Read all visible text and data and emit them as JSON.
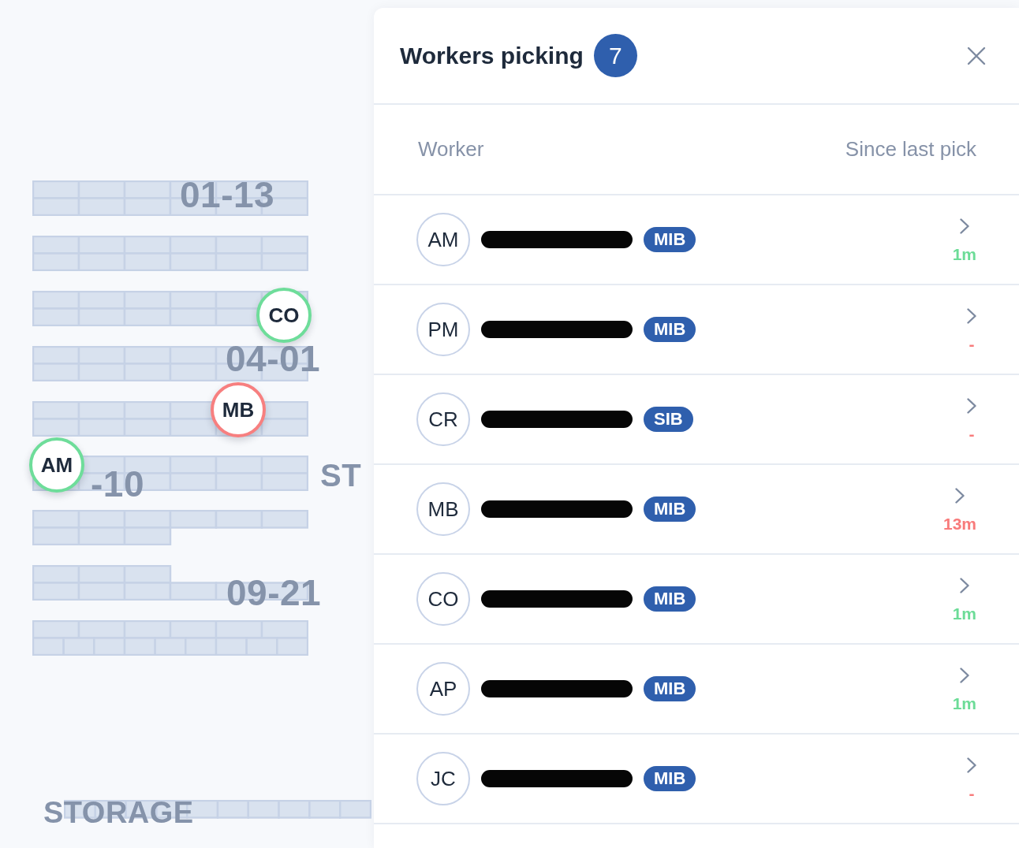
{
  "map": {
    "labels": [
      "01-13",
      "04-01",
      "-10",
      "09-21",
      "ST",
      "STORAGE"
    ],
    "markers": [
      {
        "initials": "CO",
        "color": "#6edd9a"
      },
      {
        "initials": "MB",
        "color": "#f77f7f"
      },
      {
        "initials": "AM",
        "color": "#6edd9a"
      }
    ]
  },
  "panel": {
    "title": "Workers picking",
    "count": "7",
    "columns": [
      "Worker",
      "Since last pick"
    ],
    "workers": [
      {
        "initials": "AM",
        "tag": "MIB",
        "since": "1m",
        "color": "#6cdc97"
      },
      {
        "initials": "PM",
        "tag": "MIB",
        "since": "-",
        "color": "#f87b7b"
      },
      {
        "initials": "CR",
        "tag": "SIB",
        "since": "-",
        "color": "#f87b7b"
      },
      {
        "initials": "MB",
        "tag": "MIB",
        "since": "13m",
        "color": "#f87b7b"
      },
      {
        "initials": "CO",
        "tag": "MIB",
        "since": "1m",
        "color": "#6cdc97"
      },
      {
        "initials": "AP",
        "tag": "MIB",
        "since": "1m",
        "color": "#6cdc97"
      },
      {
        "initials": "JC",
        "tag": "MIB",
        "since": "-",
        "color": "#f87b7b"
      }
    ]
  }
}
